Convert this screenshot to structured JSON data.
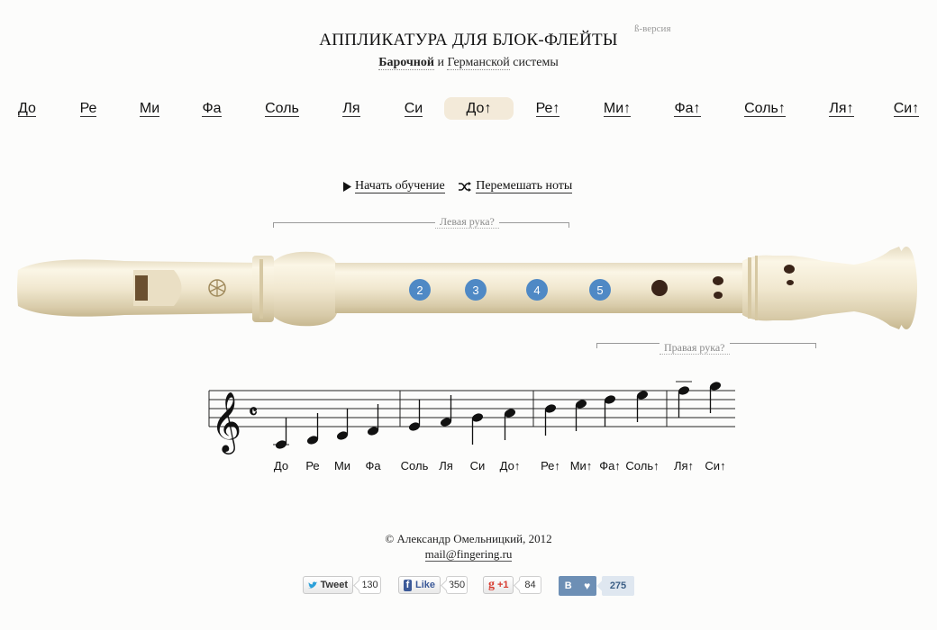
{
  "header": {
    "title": "АППЛИКАТУРА ДЛЯ БЛОК-ФЛЕЙТЫ",
    "beta": "ß-версия",
    "subtitle_baroque": "Барочной",
    "subtitle_and": "и",
    "subtitle_german": "Германской",
    "subtitle_system": "системы"
  },
  "nav": {
    "notes": [
      {
        "label": "До",
        "active": false
      },
      {
        "label": "Ре",
        "active": false
      },
      {
        "label": "Ми",
        "active": false
      },
      {
        "label": "Фа",
        "active": false
      },
      {
        "label": "Соль",
        "active": false
      },
      {
        "label": "Ля",
        "active": false
      },
      {
        "label": "Си",
        "active": false
      },
      {
        "label": "До↑",
        "active": true
      },
      {
        "label": "Ре↑",
        "active": false
      },
      {
        "label": "Ми↑",
        "active": false
      },
      {
        "label": "Фа↑",
        "active": false
      },
      {
        "label": "Соль↑",
        "active": false
      },
      {
        "label": "Ля↑",
        "active": false
      },
      {
        "label": "Си↑",
        "active": false
      }
    ]
  },
  "actions": {
    "start": "Начать обучение",
    "shuffle": "Перемешать ноты"
  },
  "hands": {
    "left": "Левая рука?",
    "right": "Правая рука?"
  },
  "flute": {
    "holes": [
      "2",
      "3",
      "4",
      "5"
    ],
    "brand_icon": "yamaha-logo-icon",
    "color": "#efe6cf",
    "hole_color": "#4f89c5"
  },
  "staff": {
    "labels": [
      "До",
      "Ре",
      "Ми",
      "Фа",
      "Соль",
      "Ля",
      "Си",
      "До↑",
      "Ре↑",
      "Ми↑",
      "Фа↑",
      "Соль↑",
      "Ля↑",
      "Си↑"
    ]
  },
  "footer": {
    "copyright": "© Александр Омельницкий, 2012",
    "mail": "mail@fingering.ru"
  },
  "social": {
    "tweet": "Tweet",
    "tweet_count": "130",
    "like": "Like",
    "like_count": "350",
    "plus": "+1",
    "plus_count": "84",
    "vk": "В",
    "vk_count": "275"
  }
}
